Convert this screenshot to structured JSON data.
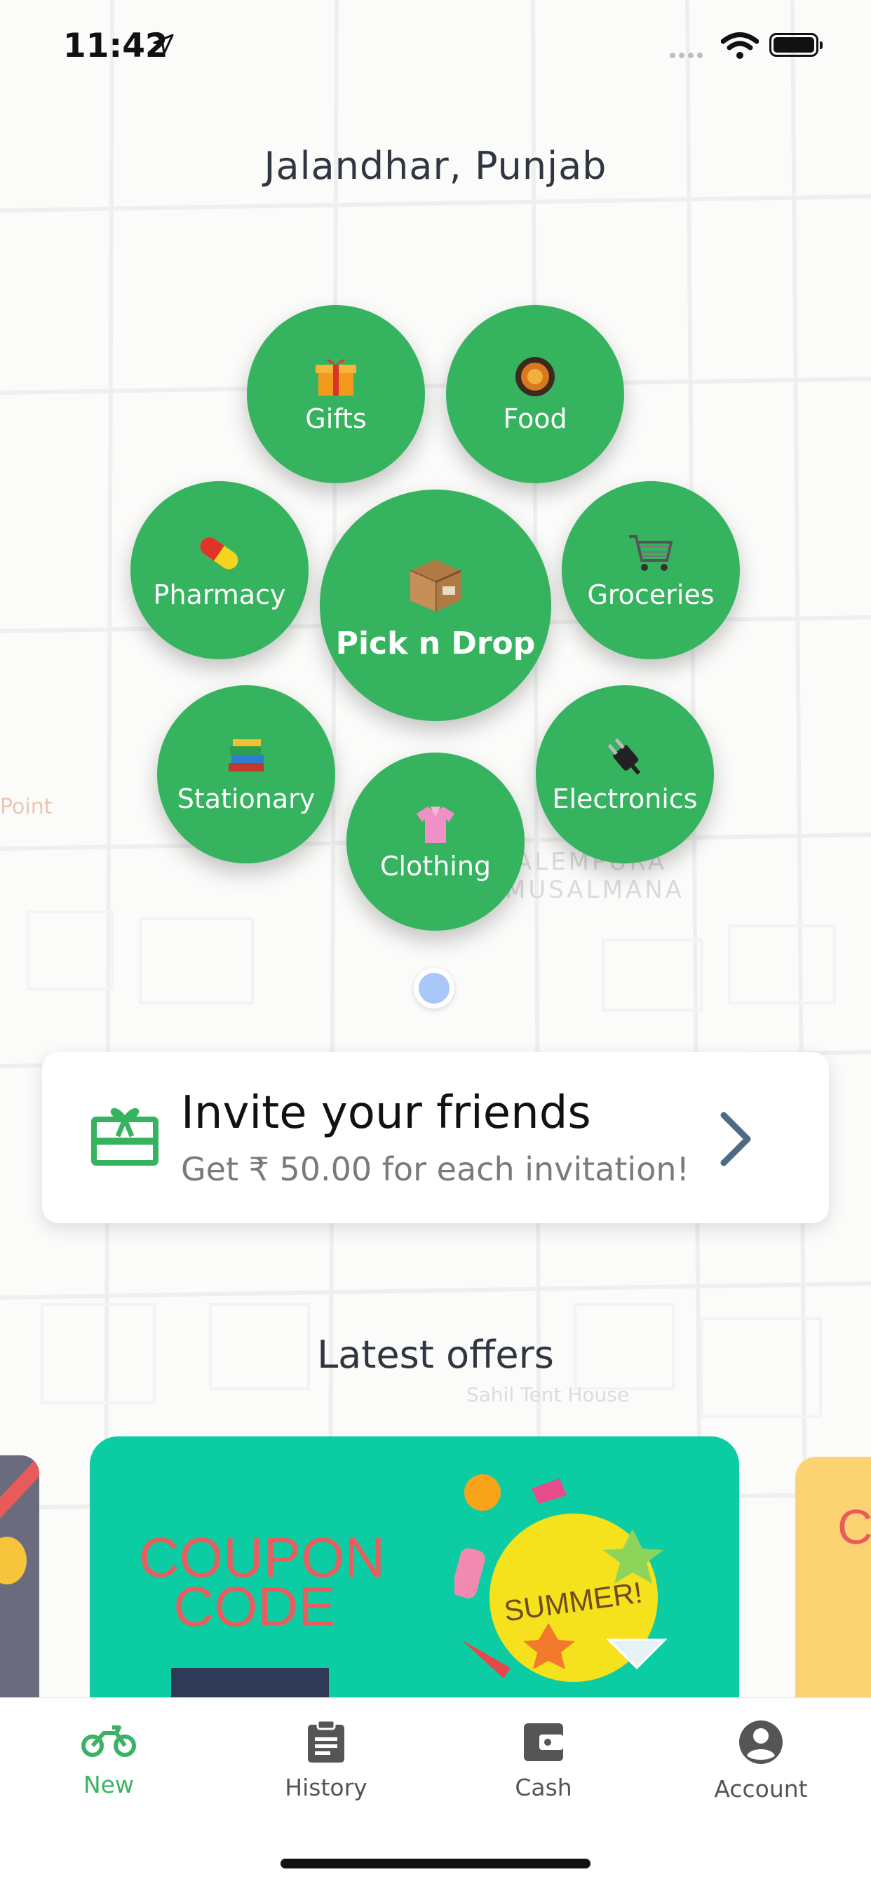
{
  "status_bar": {
    "time": "11:42"
  },
  "header": {
    "city": "Jalandhar, Punjab"
  },
  "categories": {
    "gifts": "Gifts",
    "food": "Food",
    "pharmacy": "Pharmacy",
    "pick_drop": "Pick n Drop",
    "groceries": "Groceries",
    "stationary": "Stationary",
    "electronics": "Electronics",
    "clothing": "Clothing"
  },
  "invite": {
    "title": "Invite your friends",
    "subtitle": "Get ₹ 50.00 for each invitation!"
  },
  "offers": {
    "title": "Latest offers",
    "coupon_line1": "COUPON",
    "coupon_line2": "CODE",
    "summer_text": "SUMMER!",
    "right_card_text": "C"
  },
  "map_labels": {
    "area1": "ALEMPURA",
    "area2": "MUSALMANA",
    "poi1": "Point",
    "poi2": "Sahil Tent House"
  },
  "tabs": {
    "new": "New",
    "history": "History",
    "cash": "Cash",
    "account": "Account"
  },
  "colors": {
    "accent": "#36b35e",
    "card_offer": "#0ccca3"
  }
}
